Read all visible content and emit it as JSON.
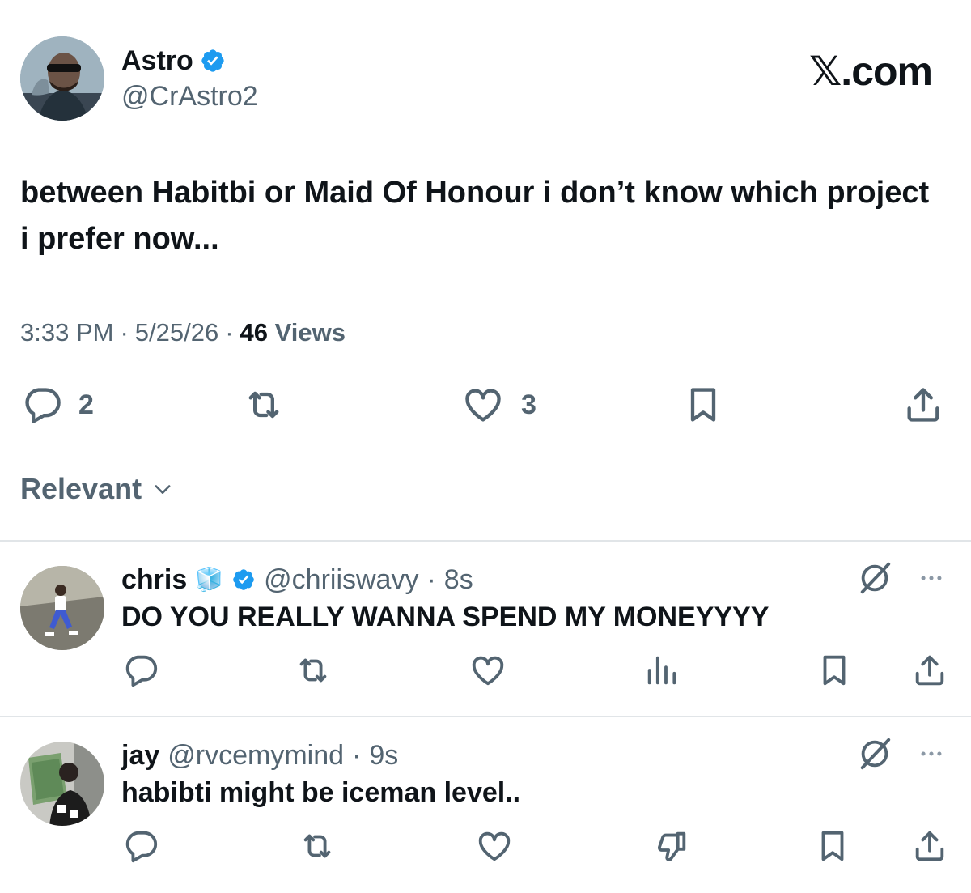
{
  "tweet": {
    "author_name": "Astro",
    "author_handle": "@CrAstro2",
    "text": "between Habitbi or Maid Of Honour i don’t know which project i prefer now...",
    "time": "3:33 PM",
    "date": "5/25/26",
    "views_count": "46",
    "views_label": "Views",
    "replies_count": "2",
    "likes_count": "3",
    "verified": true
  },
  "brand": {
    "logo_text": "𝕏.com"
  },
  "sort": {
    "label": "Relevant"
  },
  "replies": [
    {
      "name": "chris",
      "emoji": "🧊",
      "verified": true,
      "handle": "@chriiswavy",
      "time": "8s",
      "text": "DO YOU REALLY WANNA SPEND MY MONEYYYY"
    },
    {
      "name": "jay",
      "verified": false,
      "handle": "@rvcemymind",
      "time": "9s",
      "text": "habibti might be iceman level.."
    }
  ],
  "separator": "·",
  "colors": {
    "text": "#0f1419",
    "secondary": "#536471",
    "verified_blue": "#1d9bf0",
    "divider": "#e1e5e8"
  },
  "icons": [
    "reply-icon",
    "retweet-icon",
    "like-icon",
    "bookmark-icon",
    "share-icon",
    "analytics-icon",
    "dislike-icon",
    "grok-icon",
    "more-icon",
    "verified-badge-icon",
    "chevron-down-icon"
  ]
}
